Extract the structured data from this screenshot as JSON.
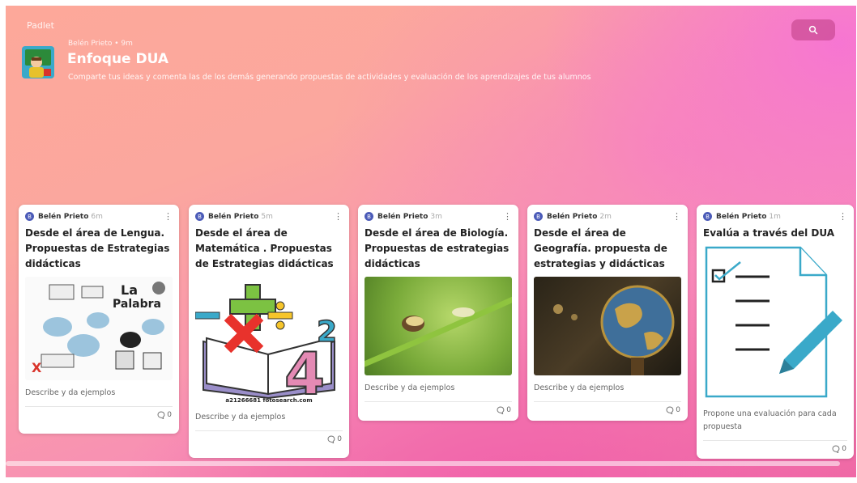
{
  "brand": "Padlet",
  "header": {
    "meta": "Belén Prieto • 9m",
    "title": "Enfoque DUA",
    "description": "Comparte tus ideas y comenta las de los demás generando propuestas de actividades y evaluación de los aprendizajes de tus alumnos"
  },
  "search": {
    "icon": "search-icon"
  },
  "cards": [
    {
      "author": "Belén Prieto",
      "initial": "B",
      "time": "6m",
      "title": "Desde el área de Lengua. Propuestas de Estrategias didácticas",
      "body": "Describe y da ejemplos",
      "comments": "0"
    },
    {
      "author": "Belén Prieto",
      "initial": "B",
      "time": "5m",
      "title": "Desde el área de Matemática . Propuestas de Estrategias didácticas",
      "image_caption": "a21266681 fotosearch.com",
      "body": "Describe y da ejemplos",
      "comments": "0"
    },
    {
      "author": "Belén Prieto",
      "initial": "B",
      "time": "3m",
      "title": "Desde el área de Biología. Propuestas de estrategias didácticas",
      "body": "Describe y da ejemplos",
      "comments": "0"
    },
    {
      "author": "Belén Prieto",
      "initial": "B",
      "time": "2m",
      "title": "Desde el área de Geografía. propuesta de estrategias y didácticas",
      "body": "Describe y da ejemplos",
      "comments": "0"
    },
    {
      "author": "Belén Prieto",
      "initial": "B",
      "time": "1m",
      "title": "Evalúa a través del DUA",
      "body": "Propone una evaluación para cada propuesta",
      "comments": "0"
    }
  ]
}
